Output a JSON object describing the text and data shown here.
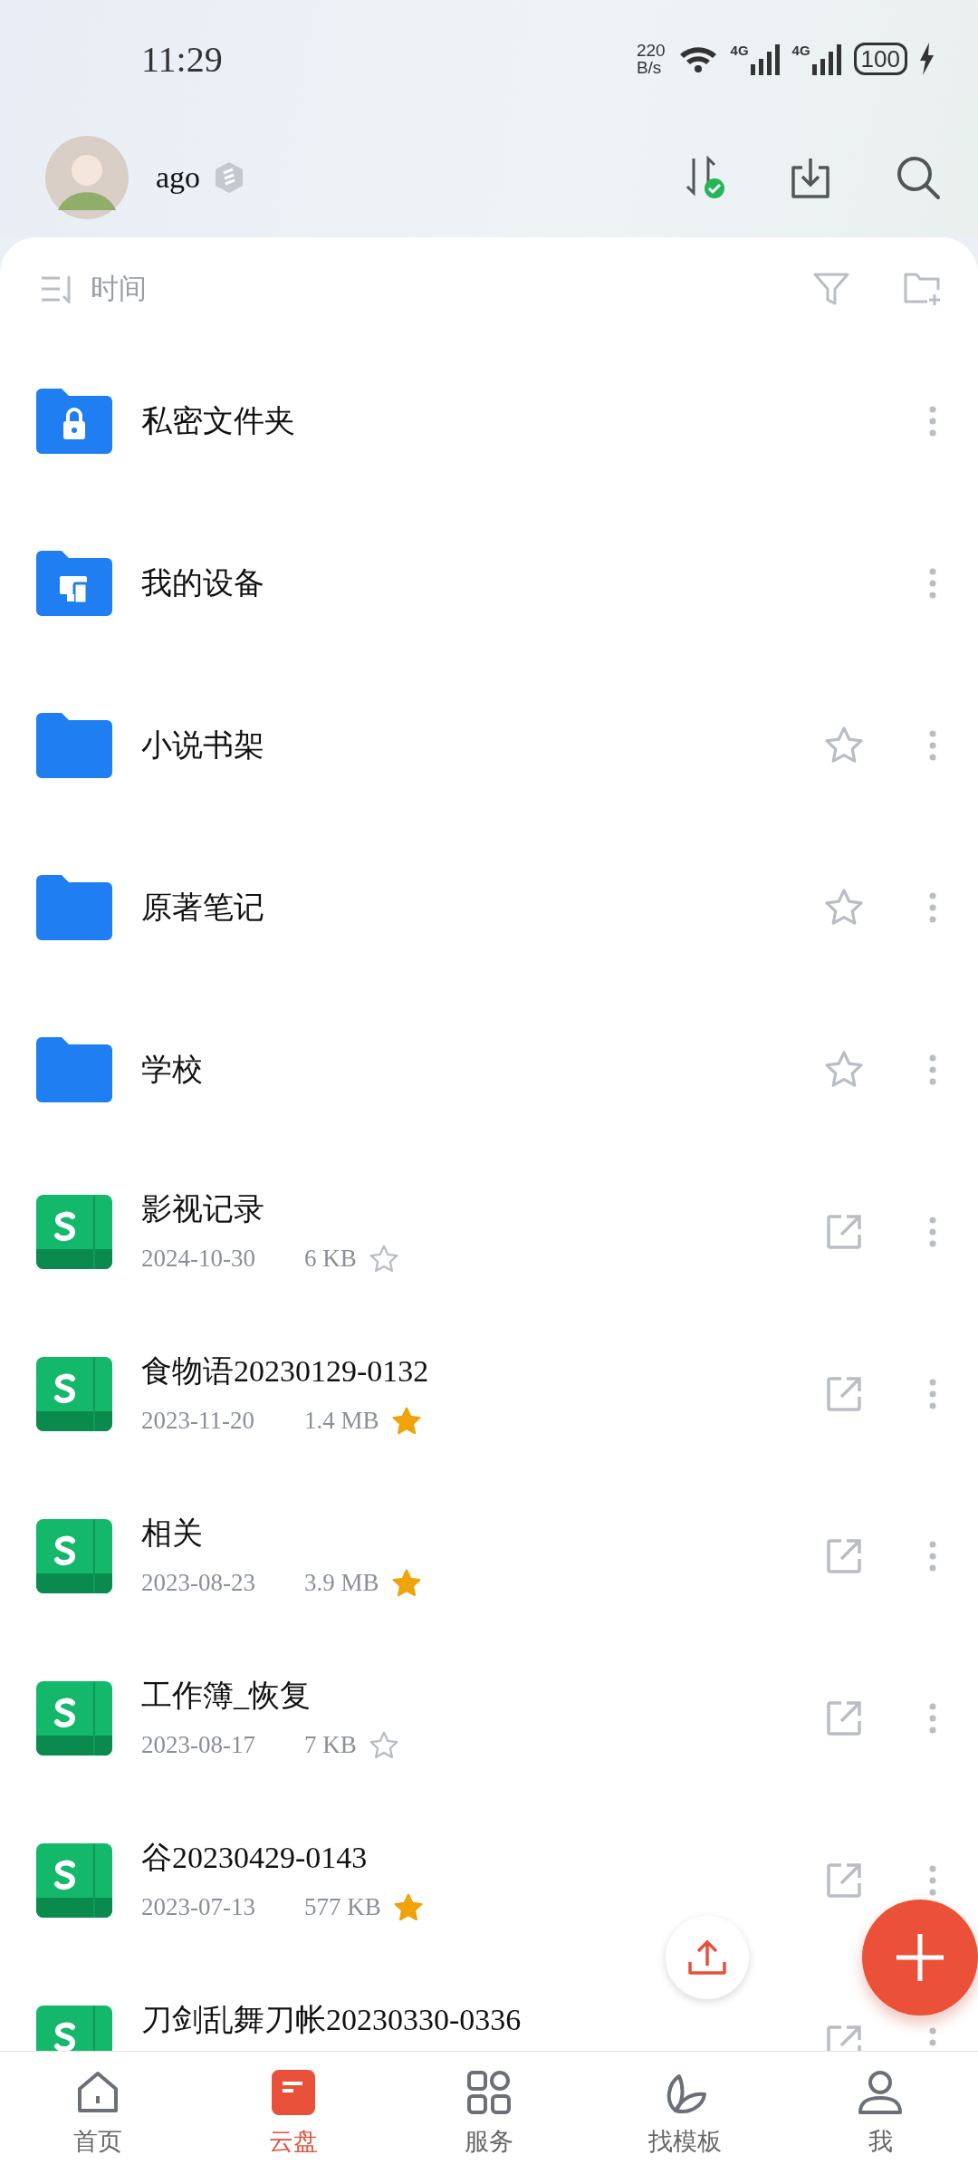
{
  "status_bar": {
    "time": "11:29",
    "net_speed": "220",
    "net_unit": "B/s",
    "signals": [
      "4G",
      "4G"
    ],
    "battery": "100"
  },
  "header": {
    "username": "ago"
  },
  "sort": {
    "label": "时间"
  },
  "items": [
    {
      "kind": "locked",
      "name": "私密文件夹"
    },
    {
      "kind": "device",
      "name": "我的设备"
    },
    {
      "kind": "folder",
      "name": "小说书架",
      "starred": false
    },
    {
      "kind": "folder",
      "name": "原著笔记",
      "starred": false
    },
    {
      "kind": "folder",
      "name": "学校",
      "starred": false
    },
    {
      "kind": "sheet",
      "name": "影视记录",
      "date": "2024-10-30",
      "size": "6 KB",
      "starred": false
    },
    {
      "kind": "sheet",
      "name": "食物语20230129-0132",
      "date": "2023-11-20",
      "size": "1.4 MB",
      "starred": true
    },
    {
      "kind": "sheet",
      "name": "相关",
      "date": "2023-08-23",
      "size": "3.9 MB",
      "starred": true
    },
    {
      "kind": "sheet",
      "name": "工作簿_恢复",
      "date": "2023-08-17",
      "size": "7 KB",
      "starred": false
    },
    {
      "kind": "sheet",
      "name": "谷20230429-0143",
      "date": "2023-07-13",
      "size": "577 KB",
      "starred": true
    },
    {
      "kind": "sheet",
      "name": "刀剑乱舞刀帐20230330-0336"
    }
  ],
  "nav": [
    {
      "label": "首页",
      "selected": false
    },
    {
      "label": "云盘",
      "selected": true
    },
    {
      "label": "服务",
      "selected": false
    },
    {
      "label": "找模板",
      "selected": false
    },
    {
      "label": "我",
      "selected": false
    }
  ]
}
